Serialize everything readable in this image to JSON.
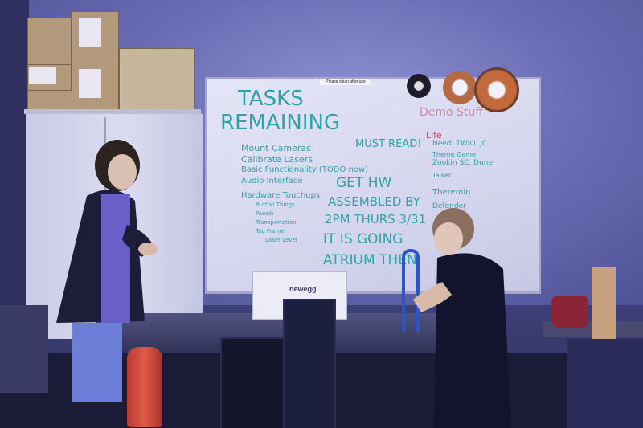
{
  "photo": {
    "description_hidden": "",
    "colors": {
      "wall": "#7a7dc4",
      "marker_teal": "#2fa3a6",
      "marker_red": "#c2456a",
      "board": "#dcdcf0"
    }
  },
  "board_sign": "Please clean after use",
  "whiteboard": {
    "title_line1": "TASKS",
    "title_line2": "REMAINING",
    "tasks": [
      "Mount Cameras",
      "Calibrate Lasers",
      "Basic Functionality (TODO now)",
      "Audio Interface"
    ],
    "hardware_header": "Hardware Touchups",
    "hardware_items": [
      "Button Things",
      "Panels",
      "Transportation",
      "Top Frame",
      "Laser Level"
    ],
    "must_read": "MUST READ!",
    "get_hw_1": "GET HW",
    "get_hw_2": "ASSEMBLED BY",
    "get_hw_3": "2PM THURS 3/31",
    "going_1": "IT IS GOING",
    "going_2": "ATRIUM THEN",
    "demo_header": "Demo Stuff",
    "demo_items": [
      "Life",
      "Need: TWIO, JC",
      "Theme Game",
      "Zookin SC, Dune",
      "Talker",
      "Theremin",
      "Defender"
    ]
  },
  "box_brand": "newegg"
}
